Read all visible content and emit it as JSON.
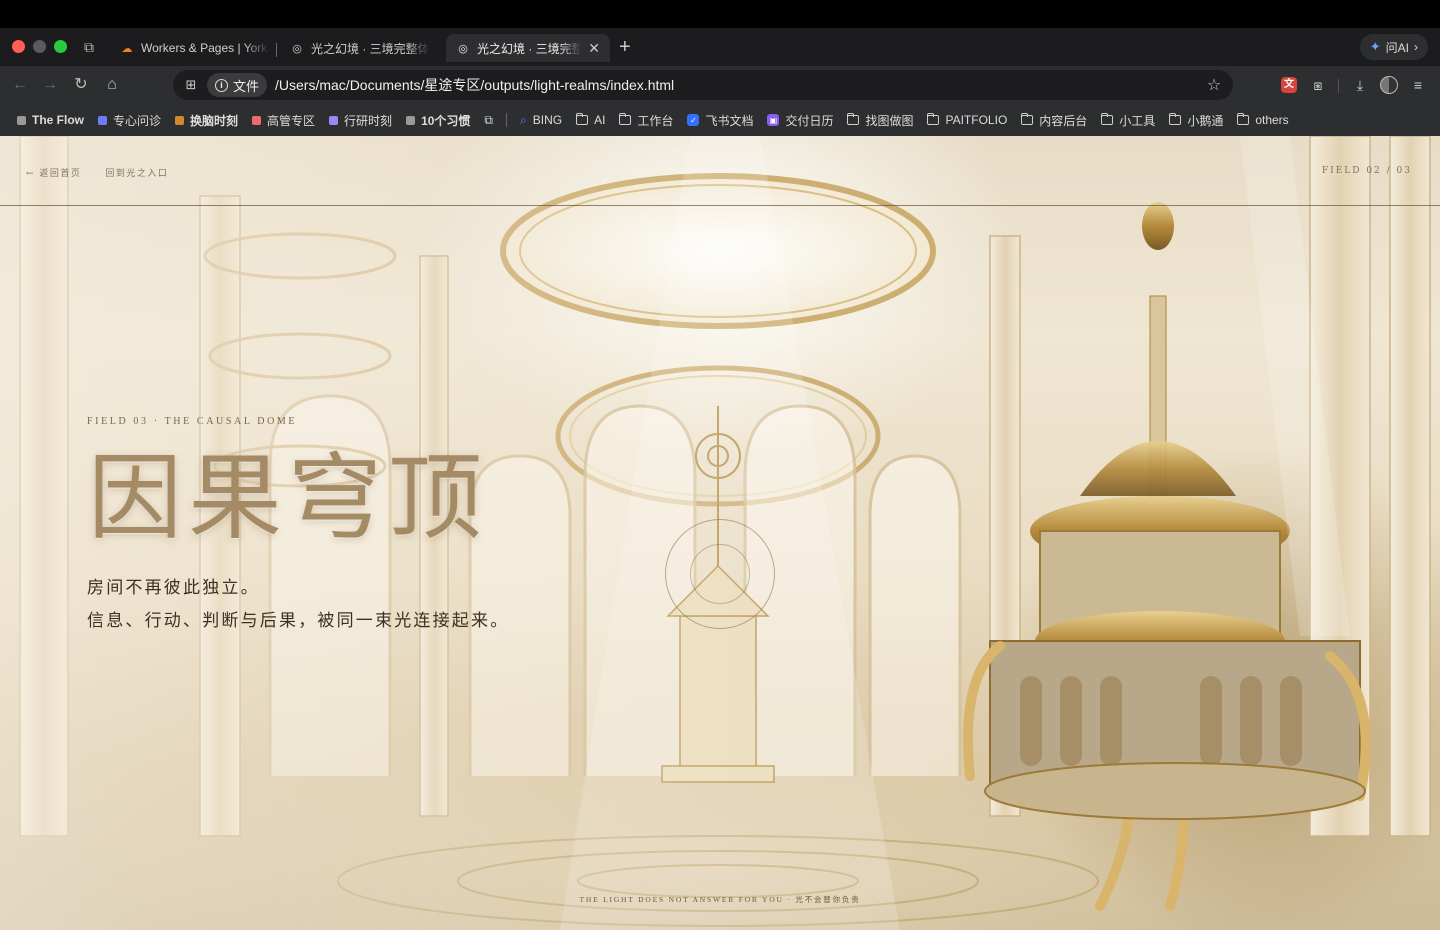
{
  "browser": {
    "tabs": [
      {
        "label": "Workers & Pages | York",
        "favicon": "cloudflare-icon"
      },
      {
        "label": "光之幻境 · 三境完整体验",
        "favicon": "globe-icon"
      },
      {
        "label": "光之幻境 · 三境完整",
        "favicon": "globe-icon",
        "active": true
      }
    ],
    "ask_ai_label": "问AI",
    "address": {
      "chip_label": "文件",
      "url": "/Users/mac/Documents/星途专区/outputs/light-realms/index.html"
    },
    "bookmarks": [
      {
        "label": "The Flow",
        "type": "dot",
        "color": "#9a9a9a"
      },
      {
        "label": "专心问诊",
        "type": "dot",
        "color": "#6b7cff"
      },
      {
        "label": "换脑时刻",
        "type": "dot",
        "color": "#d4872c"
      },
      {
        "label": "高管专区",
        "type": "dot",
        "color": "#ef6a6a"
      },
      {
        "label": "行研时刻",
        "type": "dot",
        "color": "#9a86f5"
      },
      {
        "label": "10个习惯",
        "type": "dot",
        "color": "#9a9a9a"
      },
      {
        "label": "BING",
        "type": "search"
      },
      {
        "label": "AI",
        "type": "folder"
      },
      {
        "label": "工作台",
        "type": "folder"
      },
      {
        "label": "飞书文档",
        "type": "feishu"
      },
      {
        "label": "交付日历",
        "type": "calendar"
      },
      {
        "label": "找图做图",
        "type": "folder"
      },
      {
        "label": "PAITFOLIO",
        "type": "folder"
      },
      {
        "label": "内容后台",
        "type": "folder"
      },
      {
        "label": "小工具",
        "type": "folder"
      },
      {
        "label": "小鹅通",
        "type": "folder"
      },
      {
        "label": "others",
        "type": "folder"
      }
    ]
  },
  "page": {
    "nav": {
      "back_label": "← 返回首页",
      "back_sub": "回到光之入口",
      "field_counter": "FIELD 02 / 03"
    },
    "eyebrow": "FIELD 03 · THE CAUSAL DOME",
    "title": "因果穹顶",
    "lead_line1": "房间不再彼此独立。",
    "lead_line2": "信息、行动、判断与后果，被同一束光连接起来。",
    "footer": "THE LIGHT DOES NOT ANSWER FOR YOU · 光不会替你负责"
  }
}
